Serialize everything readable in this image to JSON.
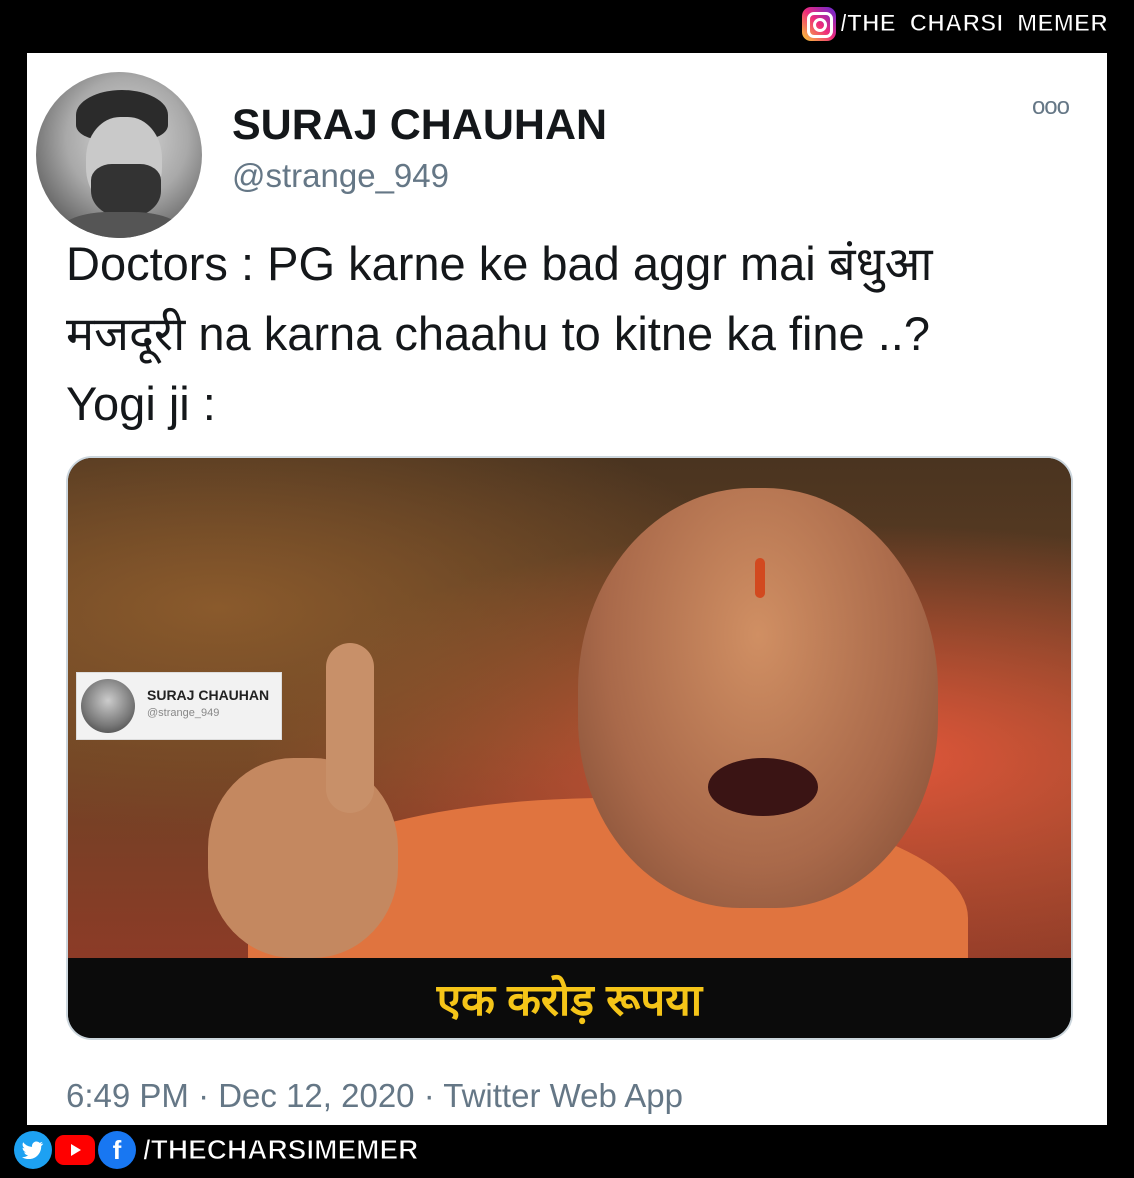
{
  "top_handle": "/THE_CHARSI_MEMER",
  "tweet": {
    "display_name": "SURAJ CHAUHAN",
    "username": "@strange_949",
    "more_icon": "ooo",
    "text_lines": [
      "Doctors : PG karne ke bad aggr mai बंधुआ",
      "मजदूरी na karna chaahu to kitne ka fine ..?",
      "Yogi ji :"
    ],
    "media": {
      "watermark_name": "SURAJ CHAUHAN",
      "watermark_username": "@strange_949",
      "caption": "एक करोड़ रूपया"
    },
    "meta": "6:49 PM · Dec 12, 2020 · Twitter Web App"
  },
  "bottom_handle": "/THECHARSIMEMER",
  "icons": [
    "instagram-icon",
    "more-icon",
    "twitter-icon",
    "youtube-icon",
    "facebook-icon"
  ],
  "colors": {
    "name": "#14171a",
    "secondary": "#657786",
    "caption": "#f5c518",
    "twitter": "#1da1f2",
    "youtube": "#ff0000",
    "facebook": "#1877f2"
  }
}
